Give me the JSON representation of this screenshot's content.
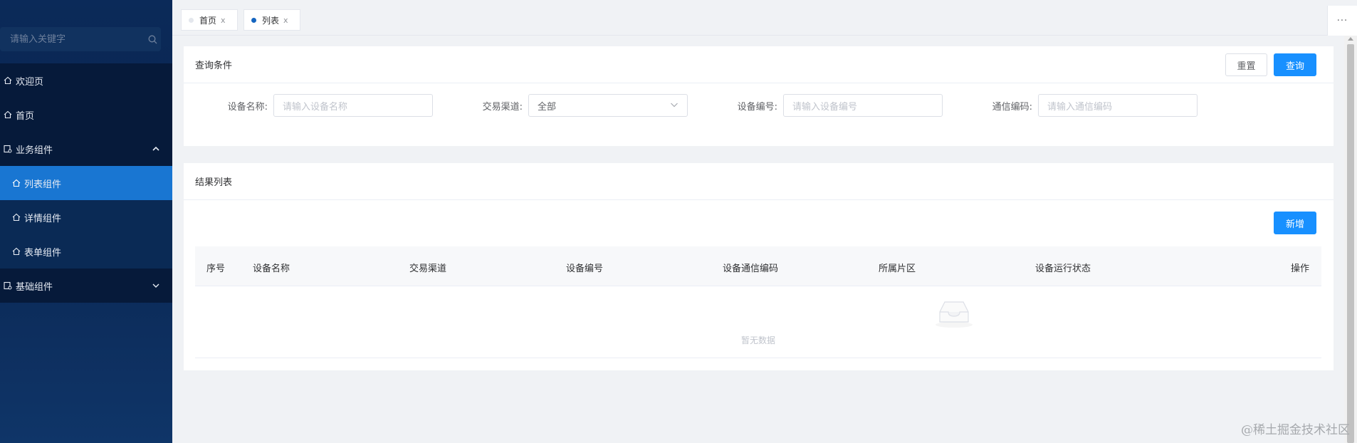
{
  "sidebar": {
    "search_placeholder": "请输入关键字",
    "items": [
      {
        "label": "欢迎页",
        "icon": "home-icon"
      },
      {
        "label": "首页",
        "icon": "home-icon"
      },
      {
        "label": "业务组件",
        "icon": "component-icon",
        "expanded": true,
        "children": [
          {
            "label": "列表组件",
            "icon": "home-icon",
            "active": true
          },
          {
            "label": "详情组件",
            "icon": "home-icon"
          },
          {
            "label": "表单组件",
            "icon": "home-icon"
          }
        ]
      },
      {
        "label": "基础组件",
        "icon": "component-icon",
        "expanded": false
      }
    ]
  },
  "tabs": [
    {
      "label": "首页",
      "close": "x",
      "active": false
    },
    {
      "label": "列表",
      "close": "x",
      "active": true
    }
  ],
  "more_label": "···",
  "query": {
    "title": "查询条件",
    "reset_label": "重置",
    "search_label": "查询",
    "fields": [
      {
        "label": "设备名称:",
        "placeholder": "请输入设备名称"
      },
      {
        "label": "交易渠道:",
        "value": "全部"
      },
      {
        "label": "设备编号:",
        "placeholder": "请输入设备编号"
      },
      {
        "label": "通信编码:",
        "placeholder": "请输入通信编码"
      }
    ]
  },
  "results": {
    "title": "结果列表",
    "add_label": "新增",
    "columns": [
      "序号",
      "设备名称",
      "交易渠道",
      "设备编号",
      "设备通信编码",
      "所属片区",
      "设备运行状态",
      "操作"
    ],
    "empty_text": "暂无数据"
  },
  "watermark": "@稀土掘金技术社区",
  "colors": {
    "primary": "#1890ff",
    "sidebar_bg": "#0b2a59",
    "sidebar_active": "#1976d2"
  }
}
